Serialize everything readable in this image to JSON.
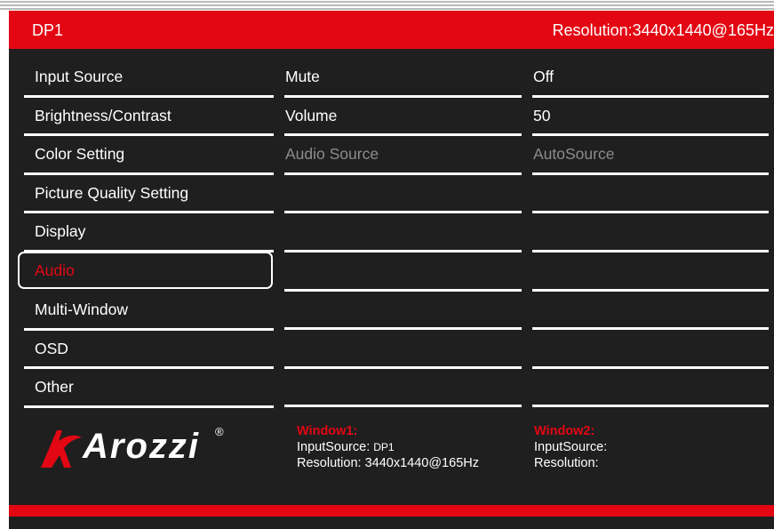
{
  "header": {
    "input": "DP1",
    "resolution": "Resolution:3440x1440@165Hz"
  },
  "menu": {
    "items": [
      {
        "label": "Input Source"
      },
      {
        "label": "Brightness/Contrast"
      },
      {
        "label": "Color Setting"
      },
      {
        "label": "Picture Quality Setting"
      },
      {
        "label": "Display"
      },
      {
        "label": "Audio",
        "selected": true
      },
      {
        "label": "Multi-Window"
      },
      {
        "label": "OSD"
      },
      {
        "label": "Other"
      }
    ]
  },
  "audio_settings": {
    "items": [
      {
        "label": "Mute",
        "value": "Off"
      },
      {
        "label": "Volume",
        "value": "50"
      },
      {
        "label": "Audio Source",
        "value": "AutoSource",
        "disabled": true
      }
    ]
  },
  "brand": {
    "logo_text": "Arozzi",
    "registered_mark": "®"
  },
  "window1": {
    "title": "Window1:",
    "input_label": "InputSource:",
    "input_value": "DP1",
    "resolution_label": "Resolution:",
    "resolution_value": "3440x1440@165Hz"
  },
  "window2": {
    "title": "Window2:",
    "input_label": "InputSource:",
    "resolution_label": "Resolution:"
  },
  "colors": {
    "accent": "#e30613",
    "panel": "#1f1f1f",
    "text": "#ffffff",
    "disabled": "#8c8c8c"
  }
}
